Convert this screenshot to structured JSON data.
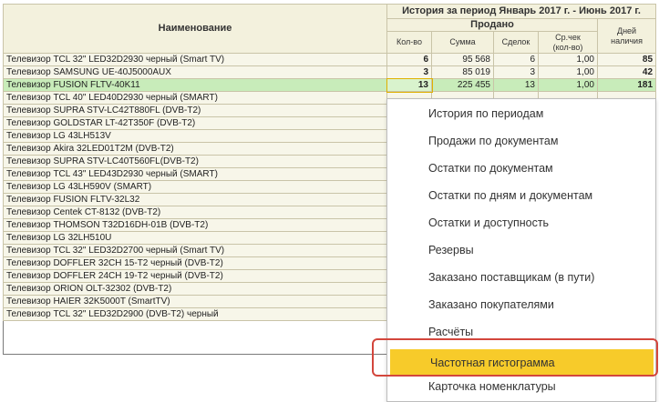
{
  "header": {
    "name": "Наименование",
    "period": "История за период Январь 2017 г. - Июнь 2017 г.",
    "sold": "Продано",
    "qty": "Кол-во",
    "sum": "Сумма",
    "deals": "Сделок",
    "avg_check_1": "Ср.чек",
    "avg_check_2": "(кол-во)",
    "days_1": "Дней",
    "days_2": "наличия"
  },
  "rows": [
    {
      "name": "Телевизор TCL 32\" LED32D2930 черный (Smart TV)",
      "qty": "6",
      "sum": "95 568",
      "deals": "6",
      "avg": "1,00",
      "days": "85"
    },
    {
      "name": "Телевизор SAMSUNG UE-40J5000AUX",
      "qty": "3",
      "sum": "85 019",
      "deals": "3",
      "avg": "1,00",
      "days": "42"
    },
    {
      "name": "Телевизор FUSION FLTV-40K11",
      "qty": "13",
      "sum": "225 455",
      "deals": "13",
      "avg": "1,00",
      "days": "181"
    },
    {
      "name": "Телевизор TCL 40\" LED40D2930 черный (SMART)",
      "qty": "",
      "sum": "",
      "deals": "",
      "avg": "",
      "days": ""
    },
    {
      "name": "Телевизор SUPRA STV-LC42T880FL (DVB-T2)",
      "qty": "",
      "sum": "",
      "deals": "",
      "avg": "",
      "days": ""
    },
    {
      "name": "Телевизор GOLDSTAR LT-42T350F (DVB-T2)",
      "qty": "",
      "sum": "",
      "deals": "",
      "avg": "",
      "days": ""
    },
    {
      "name": "Телевизор LG 43LH513V",
      "qty": "",
      "sum": "",
      "deals": "",
      "avg": "",
      "days": ""
    },
    {
      "name": "Телевизор Akira 32LED01T2M (DVB-T2)",
      "qty": "",
      "sum": "",
      "deals": "",
      "avg": "",
      "days": ""
    },
    {
      "name": "Телевизор SUPRA STV-LC40T560FL(DVB-T2)",
      "qty": "",
      "sum": "",
      "deals": "",
      "avg": "",
      "days": ""
    },
    {
      "name": "Телевизор TCL 43\" LED43D2930 черный (SMART)",
      "qty": "",
      "sum": "",
      "deals": "",
      "avg": "",
      "days": ""
    },
    {
      "name": "Телевизор LG 43LH590V (SMART)",
      "qty": "",
      "sum": "",
      "deals": "",
      "avg": "",
      "days": ""
    },
    {
      "name": "Телевизор FUSION FLTV-32L32",
      "qty": "",
      "sum": "",
      "deals": "",
      "avg": "",
      "days": ""
    },
    {
      "name": "Телевизор Centek CT-8132 (DVB-T2)",
      "qty": "",
      "sum": "",
      "deals": "",
      "avg": "",
      "days": ""
    },
    {
      "name": "Телевизор THOMSON T32D16DH-01B (DVB-T2)",
      "qty": "",
      "sum": "",
      "deals": "",
      "avg": "",
      "days": ""
    },
    {
      "name": "Телевизор LG 32LH510U",
      "qty": "",
      "sum": "",
      "deals": "",
      "avg": "",
      "days": ""
    },
    {
      "name": "Телевизор TCL 32\" LED32D2700 черный (Smart TV)",
      "qty": "",
      "sum": "",
      "deals": "",
      "avg": "",
      "days": ""
    },
    {
      "name": "Телевизор DOFFLER 32CH 15-T2 черный (DVB-T2)",
      "qty": "",
      "sum": "",
      "deals": "",
      "avg": "",
      "days": ""
    },
    {
      "name": "Телевизор DOFFLER 24CH 19-T2 черный (DVB-T2)",
      "qty": "",
      "sum": "",
      "deals": "",
      "avg": "",
      "days": ""
    },
    {
      "name": "Телевизор ORION OLT-32302 (DVB-T2)",
      "qty": "",
      "sum": "",
      "deals": "",
      "avg": "",
      "days": ""
    },
    {
      "name": "Телевизор HAIER 32K5000T (SmartTV)",
      "qty": "",
      "sum": "",
      "deals": "",
      "avg": "",
      "days": ""
    },
    {
      "name": "Телевизор TCL 32\" LED32D2900 (DVB-T2) черный",
      "qty": "",
      "sum": "",
      "deals": "",
      "avg": "",
      "days": ""
    }
  ],
  "selected_row": 2,
  "menu": {
    "items": [
      "История по периодам",
      "Продажи по документам",
      "Остатки по документам",
      "Остатки по дням и документам",
      "Остатки и доступность",
      "Резервы",
      "Заказано поставщикам (в пути)",
      "Заказано покупателями",
      "Расчёты",
      "Частотная гистограмма",
      "Карточка номенклатуры"
    ],
    "active_index": 9
  },
  "colors": {
    "header_bg": "#f3f1dd",
    "row_bg": "#f7f6e9",
    "selected_row_bg": "#c8ecba",
    "menu_active_bg": "#f7cb2a",
    "highlight_frame": "#d3463c"
  }
}
